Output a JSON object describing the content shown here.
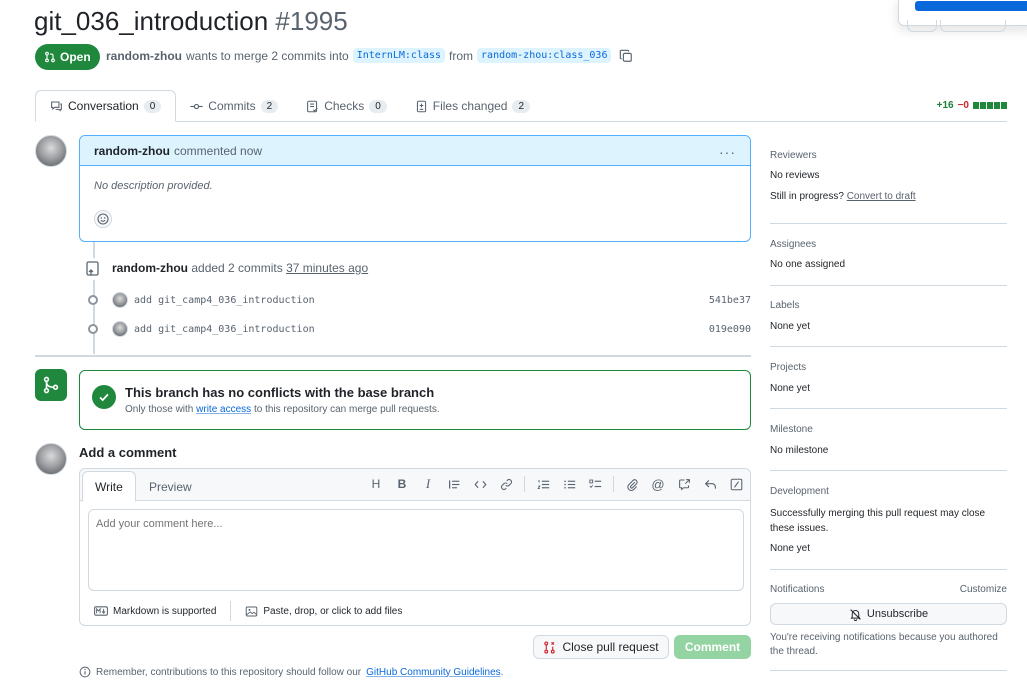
{
  "header": {
    "title": "git_036_introduction",
    "number": "#1995",
    "state": "Open",
    "author": "random-zhou",
    "merge_text": "wants to merge 2 commits into",
    "base_branch": "InternLM:class",
    "from_text": "from",
    "head_branch": "random-zhou:class_036"
  },
  "tabs": [
    {
      "label": "Conversation",
      "count": "0"
    },
    {
      "label": "Commits",
      "count": "2"
    },
    {
      "label": "Checks",
      "count": "0"
    },
    {
      "label": "Files changed",
      "count": "2"
    }
  ],
  "diffstat": {
    "additions": "+16",
    "deletions": "−0"
  },
  "comment": {
    "author": "random-zhou",
    "action": "commented now",
    "body": "No description provided."
  },
  "timeline": {
    "author": "random-zhou",
    "text": "added 2 commits",
    "time": "37 minutes ago",
    "commits": [
      {
        "message": "add git_camp4_036_introduction",
        "sha": "541be37"
      },
      {
        "message": "add git_camp4_036_introduction",
        "sha": "019e090"
      }
    ]
  },
  "merge": {
    "title": "This branch has no conflicts with the base branch",
    "sub_pre": "Only those with",
    "sub_link": "write access",
    "sub_post": "to this repository can merge pull requests."
  },
  "add_comment": {
    "title": "Add a comment",
    "tab_write": "Write",
    "tab_preview": "Preview",
    "placeholder": "Add your comment here...",
    "markdown": "Markdown is supported",
    "attach": "Paste, drop, or click to add files"
  },
  "buttons": {
    "close": "Close pull request",
    "comment": "Comment"
  },
  "note": {
    "pre": "Remember, contributions to this repository should follow our",
    "link": "GitHub Community Guidelines",
    "post": "."
  },
  "sidebar": {
    "reviewers_label": "Reviewers",
    "reviewers_value": "No reviews",
    "in_progress": "Still in progress?",
    "convert": "Convert to draft",
    "assignees_label": "Assignees",
    "assignees_value": "No one assigned",
    "labels_label": "Labels",
    "labels_value": "None yet",
    "projects_label": "Projects",
    "projects_value": "None yet",
    "milestone_label": "Milestone",
    "milestone_value": "No milestone",
    "development_label": "Development",
    "development_text": "Successfully merging this pull request may close these issues.",
    "development_value": "None yet",
    "notifications_label": "Notifications",
    "customize": "Customize",
    "unsubscribe": "Unsubscribe",
    "notif_text": "You're receiving notifications because you authored the thread."
  },
  "colors": {
    "accent": "#0969da",
    "open_green": "#1f883d",
    "border": "#d1d9e0"
  }
}
